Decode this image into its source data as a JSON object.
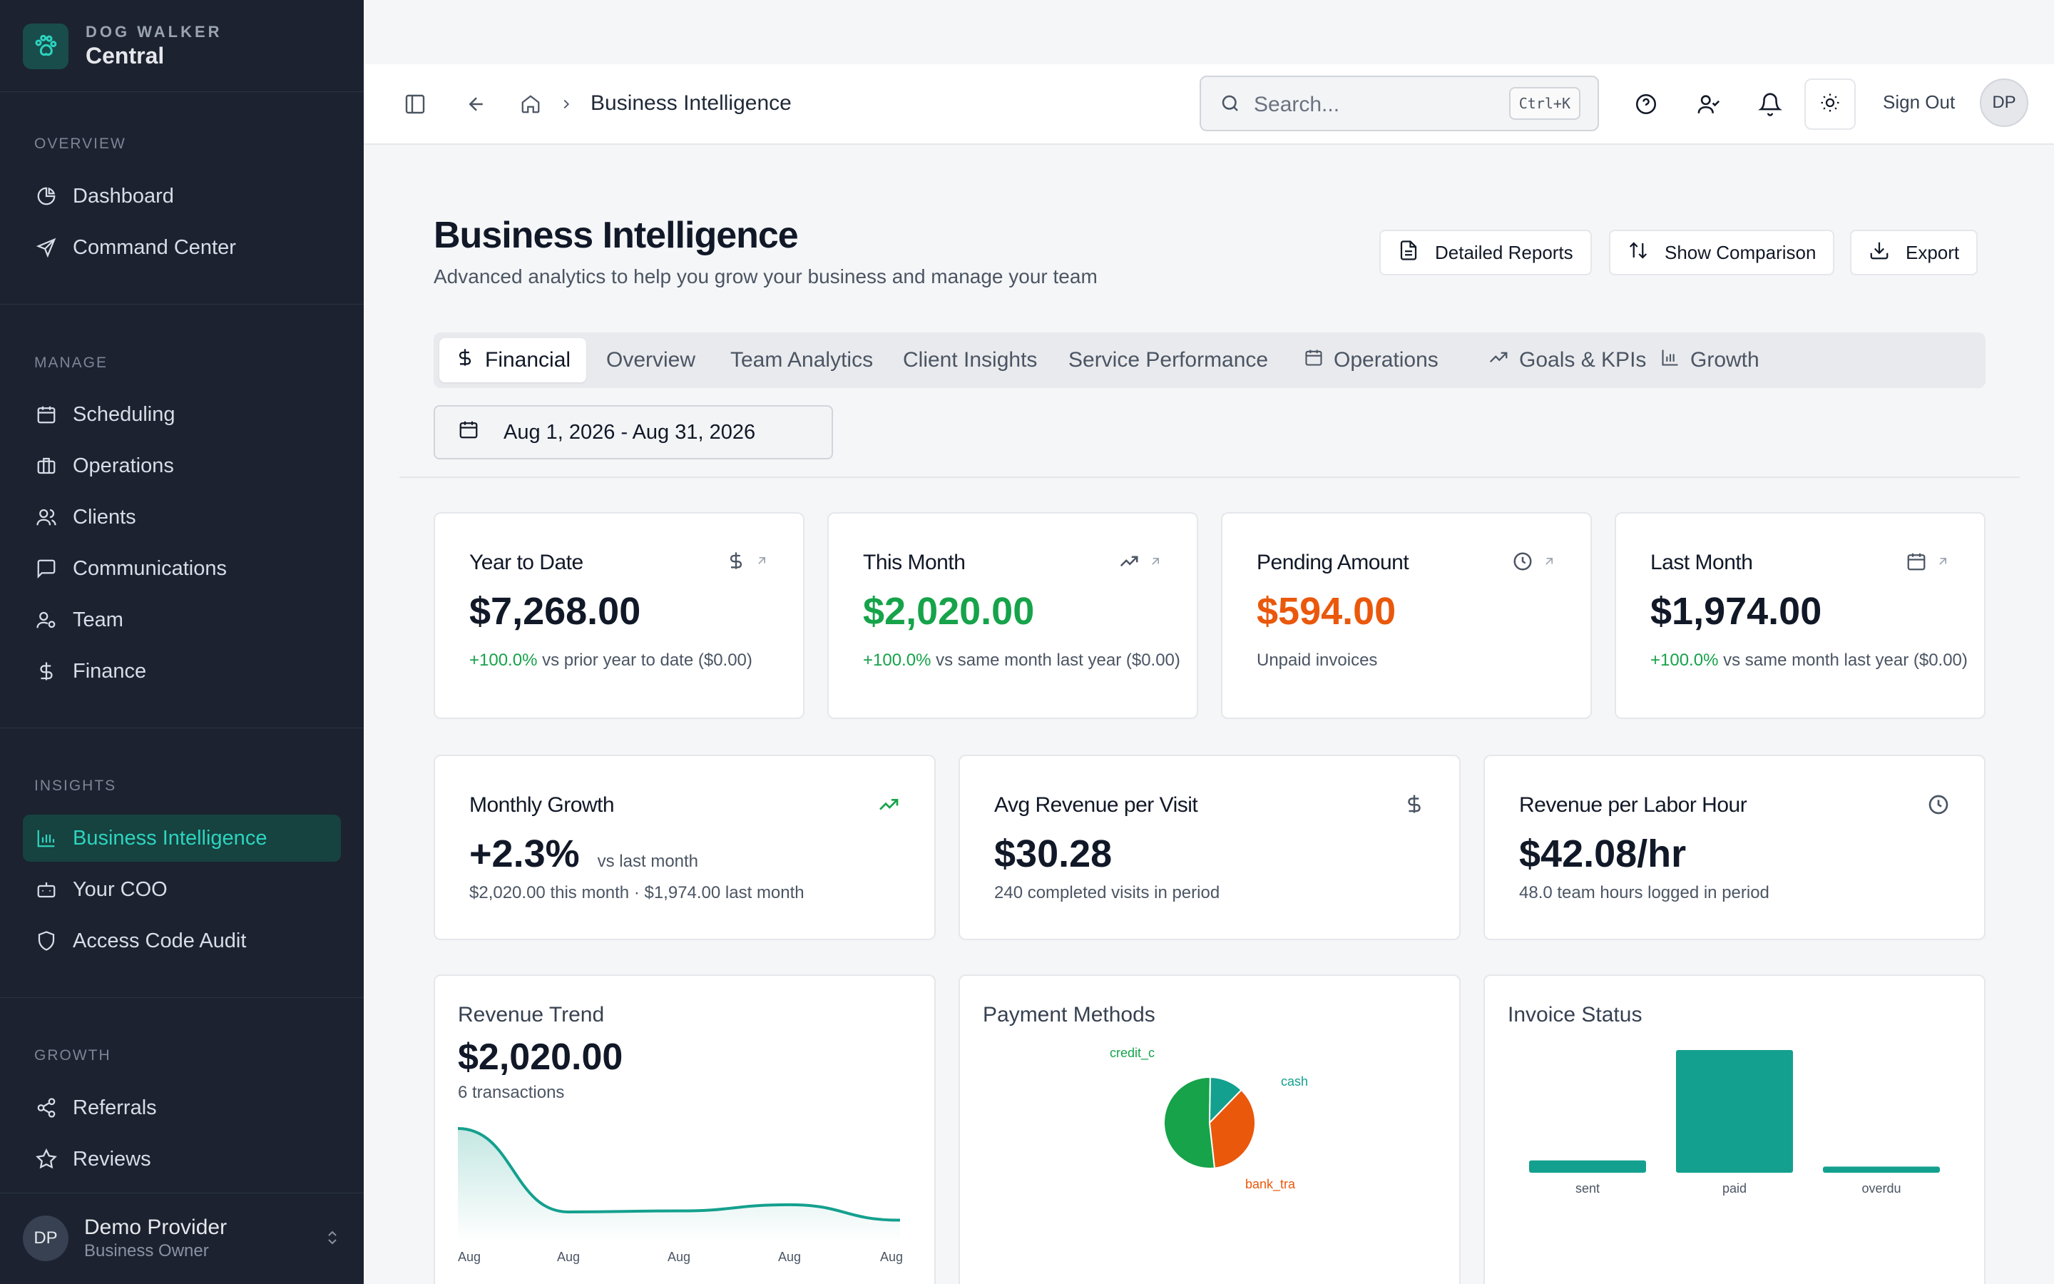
{
  "brand": {
    "small": "DOG WALKER",
    "big": "Central"
  },
  "sidebar": {
    "sections": [
      {
        "title": "OVERVIEW",
        "items": [
          {
            "label": "Dashboard",
            "icon": "pie-chart-icon"
          },
          {
            "label": "Command Center",
            "icon": "send-icon"
          }
        ]
      },
      {
        "title": "MANAGE",
        "items": [
          {
            "label": "Scheduling",
            "icon": "calendar-icon"
          },
          {
            "label": "Operations",
            "icon": "briefcase-icon"
          },
          {
            "label": "Clients",
            "icon": "users-icon"
          },
          {
            "label": "Communications",
            "icon": "message-icon"
          },
          {
            "label": "Team",
            "icon": "team-icon"
          },
          {
            "label": "Finance",
            "icon": "dollar-icon"
          }
        ]
      },
      {
        "title": "INSIGHTS",
        "items": [
          {
            "label": "Business Intelligence",
            "icon": "bar-chart-icon",
            "active": true
          },
          {
            "label": "Your COO",
            "icon": "bot-icon"
          },
          {
            "label": "Access Code Audit",
            "icon": "shield-icon"
          }
        ]
      },
      {
        "title": "GROWTH",
        "items": [
          {
            "label": "Referrals",
            "icon": "share-icon"
          },
          {
            "label": "Reviews",
            "icon": "star-icon"
          }
        ]
      }
    ],
    "user": {
      "initials": "DP",
      "name": "Demo Provider",
      "role": "Business Owner"
    }
  },
  "topbar": {
    "breadcrumb": "Business Intelligence",
    "search_placeholder": "Search...",
    "search_shortcut": "Ctrl+K",
    "sign_out": "Sign Out",
    "avatar_initials": "DP"
  },
  "header": {
    "title": "Business Intelligence",
    "subtitle": "Advanced analytics to help you grow your business and manage your team",
    "buttons": {
      "reports": "Detailed Reports",
      "comparison": "Show Comparison",
      "export": "Export"
    }
  },
  "tabs": [
    {
      "label": "Financial",
      "icon": "dollar-icon",
      "active": true
    },
    {
      "label": "Overview"
    },
    {
      "label": "Team Analytics"
    },
    {
      "label": "Client Insights"
    },
    {
      "label": "Service Performance"
    },
    {
      "label": "Operations",
      "icon": "calendar-icon"
    },
    {
      "label": "Goals & KPIs",
      "icon": "trending-up-icon"
    },
    {
      "label": "Growth",
      "icon": "bar-chart-icon"
    }
  ],
  "date_range": "Aug 1, 2026 - Aug 31, 2026",
  "stat_cards": [
    {
      "label": "Year to Date",
      "value": "$7,268.00",
      "change": "+100.0%",
      "note": " vs prior year to date ($0.00)"
    },
    {
      "label": "This Month",
      "value": "$2,020.00",
      "change": "+100.0%",
      "note": " vs same month last year ($0.00)"
    },
    {
      "label": "Pending Amount",
      "value": "$594.00",
      "change": "",
      "note": "Unpaid invoices"
    },
    {
      "label": "Last Month",
      "value": "$1,974.00",
      "change": "+100.0%",
      "note": " vs same month last year ($0.00)"
    }
  ],
  "metric_cards": [
    {
      "label": "Monthly Growth",
      "value": "+2.3%",
      "value_note": "vs last month",
      "sub": "$2,020.00 this month · $1,974.00 last month"
    },
    {
      "label": "Avg Revenue per Visit",
      "value": "$30.28",
      "sub": "240 completed visits in period"
    },
    {
      "label": "Revenue per Labor Hour",
      "value": "$42.08/hr",
      "sub": "48.0 team hours logged in period"
    }
  ],
  "revenue_trend": {
    "title": "Revenue Trend",
    "value": "$2,020.00",
    "sub": "6 transactions"
  },
  "payment_methods": {
    "title": "Payment Methods"
  },
  "invoice_status": {
    "title": "Invoice Status"
  },
  "chart_data": [
    {
      "type": "area",
      "title": "Revenue Trend",
      "categories": [
        "Aug",
        "Aug",
        "Aug",
        "Aug",
        "Aug"
      ],
      "values": [
        900,
        90,
        100,
        160,
        10
      ],
      "color": "#14a08e"
    },
    {
      "type": "pie",
      "title": "Payment Methods",
      "labels": [
        "credit_c",
        "cash",
        "bank_tra"
      ],
      "values": [
        52,
        12,
        36
      ],
      "colors": [
        "#16a34a",
        "#14a08e",
        "#ea580c"
      ]
    },
    {
      "type": "bar",
      "title": "Invoice Status",
      "categories": [
        "sent",
        "paid",
        "overdu"
      ],
      "values": [
        10,
        100,
        5
      ],
      "color": "#14a08e"
    }
  ]
}
